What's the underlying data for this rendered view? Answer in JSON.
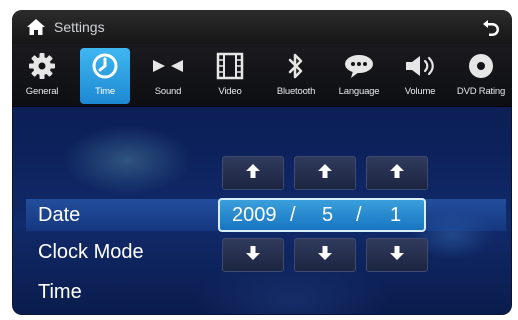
{
  "header": {
    "title": "Settings",
    "home_icon": "home-icon",
    "back_icon": "back-arrow-icon"
  },
  "tabs": [
    {
      "label": "General",
      "icon": "gear-icon",
      "active": false
    },
    {
      "label": "Time",
      "icon": "clock-icon",
      "active": true
    },
    {
      "label": "Sound",
      "icon": "speaker-pair-icon",
      "active": false
    },
    {
      "label": "Video",
      "icon": "film-icon",
      "active": false
    },
    {
      "label": "Bluetooth",
      "icon": "bluetooth-icon",
      "active": false
    },
    {
      "label": "Language",
      "icon": "speech-bubble-icon",
      "active": false
    },
    {
      "label": "Volume",
      "icon": "volume-icon",
      "active": false
    },
    {
      "label": "DVD Rating",
      "icon": "disc-icon",
      "active": false
    }
  ],
  "settings_rows": [
    {
      "label": "Date",
      "selected": true
    },
    {
      "label": "Clock Mode",
      "selected": false
    },
    {
      "label": "Time",
      "selected": false
    }
  ],
  "date": {
    "year": "2009",
    "month": "5",
    "day": "1",
    "separator": "/"
  },
  "colors": {
    "accent": "#2a9be0",
    "title_bar": "#1e1e1e",
    "background": "#0f2158"
  }
}
